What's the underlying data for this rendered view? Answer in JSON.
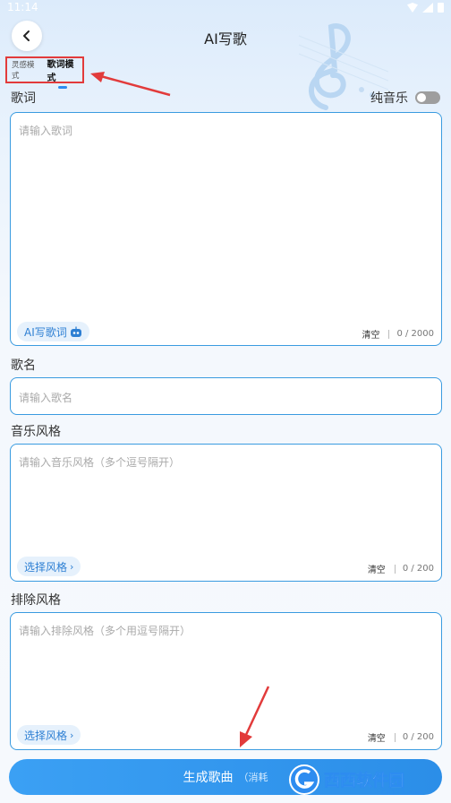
{
  "status_bar": {
    "time": "11:14"
  },
  "header": {
    "title": "AI写歌"
  },
  "mode_tabs": {
    "inspiration": "灵感模式",
    "lyrics": "歌词模式"
  },
  "lyrics": {
    "label": "歌词",
    "pure_music_label": "纯音乐",
    "pure_music_on": false,
    "placeholder": "请输入歌词",
    "ai_write_label": "AI写歌词",
    "clear_label": "清空",
    "count": "0 / 2000"
  },
  "song_name": {
    "label": "歌名",
    "placeholder": "请输入歌名"
  },
  "style": {
    "label": "音乐风格",
    "placeholder": "请输入音乐风格（多个逗号隔开）",
    "select_label": "选择风格",
    "clear_label": "清空",
    "count": "0 / 200"
  },
  "exclude": {
    "label": "排除风格",
    "placeholder": "请输入排除风格（多个用逗号隔开）",
    "select_label": "选择风格",
    "clear_label": "清空",
    "count": "0 / 200"
  },
  "generate": {
    "label": "生成歌曲",
    "sub": "（消耗"
  },
  "watermark": {
    "text": "西西软件园",
    "sub": "CR173.com"
  },
  "colors": {
    "accent": "#2d8cf0",
    "annotation": "#e23b3b"
  }
}
